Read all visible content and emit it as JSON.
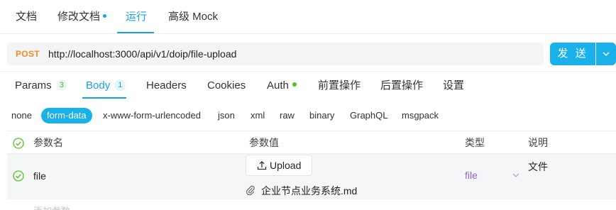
{
  "top_tabs": [
    {
      "label": "文档"
    },
    {
      "label": "修改文档"
    },
    {
      "label": "运行"
    },
    {
      "label": "高级 Mock"
    }
  ],
  "request": {
    "method": "POST",
    "url": "http://localhost:3000/api/v1/doip/file-upload",
    "send_label": "发 送"
  },
  "param_tabs": [
    {
      "label": "Params",
      "count": "3"
    },
    {
      "label": "Body",
      "count": "1"
    },
    {
      "label": "Headers"
    },
    {
      "label": "Cookies"
    },
    {
      "label": "Auth"
    },
    {
      "label": "前置操作"
    },
    {
      "label": "后置操作"
    },
    {
      "label": "设置"
    }
  ],
  "body_types": [
    "none",
    "form-data",
    "x-www-form-urlencoded",
    "json",
    "xml",
    "raw",
    "binary",
    "GraphQL",
    "msgpack"
  ],
  "table": {
    "headers": {
      "name": "参数名",
      "value": "参数值",
      "type": "类型",
      "desc": "说明"
    },
    "rows": [
      {
        "name": "file",
        "upload_label": "Upload",
        "file_name": "企业节点业务系统.md",
        "type": "file",
        "desc": "文件"
      }
    ],
    "add_placeholder": "添加参数"
  },
  "colors": {
    "accent": "#17a3e0",
    "method": "#f28c2a",
    "type": "#8a63d2",
    "success": "#52c41a"
  }
}
